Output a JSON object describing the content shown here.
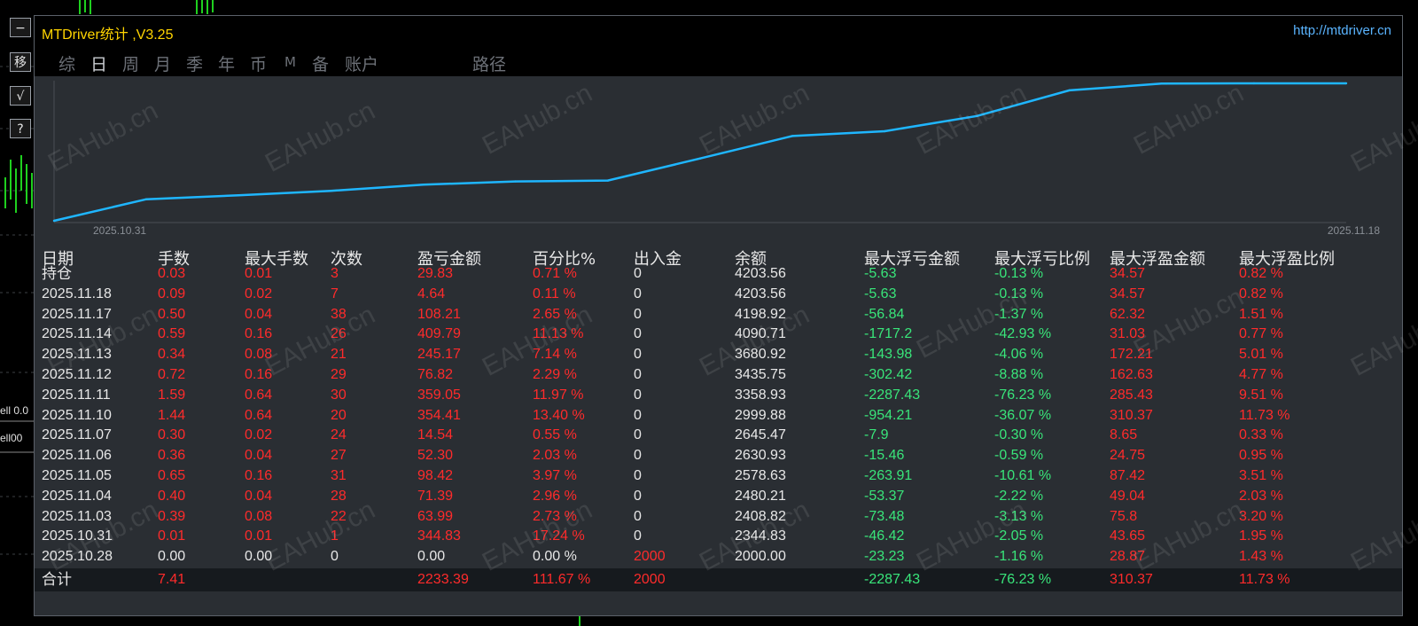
{
  "window": {
    "title": "MTDriver统计 ,V3.25",
    "url": "http://mtdriver.cn"
  },
  "side_buttons": [
    {
      "label": "−",
      "icon": "minimize-icon"
    },
    {
      "label": "移",
      "icon": "move-icon"
    },
    {
      "label": "√",
      "icon": "check-icon"
    },
    {
      "label": "?",
      "icon": "help-icon"
    }
  ],
  "side_labels": [
    "ell 0.0",
    "ell00"
  ],
  "tabs": [
    {
      "label": "综",
      "active": false
    },
    {
      "label": "日",
      "active": true
    },
    {
      "label": "周",
      "active": false
    },
    {
      "label": "月",
      "active": false
    },
    {
      "label": "季",
      "active": false
    },
    {
      "label": "年",
      "active": false
    },
    {
      "label": "币",
      "active": false
    },
    {
      "label": "M",
      "active": false
    },
    {
      "label": "备",
      "active": false
    },
    {
      "label": "账户",
      "active": false
    }
  ],
  "path_label": "路径",
  "watermark_text": "EAHub.cn",
  "chart_data": {
    "type": "line",
    "x": [
      "2025.10.28",
      "2025.10.31",
      "2025.11.03",
      "2025.11.04",
      "2025.11.05",
      "2025.11.06",
      "2025.11.07",
      "2025.11.10",
      "2025.11.11",
      "2025.11.12",
      "2025.11.13",
      "2025.11.14",
      "2025.11.17",
      "2025.11.18",
      "持仓"
    ],
    "y": [
      2000.0,
      2344.83,
      2408.82,
      2480.21,
      2578.63,
      2630.93,
      2645.47,
      2999.88,
      3358.93,
      3435.75,
      3680.92,
      4090.71,
      4198.92,
      4203.56,
      4203.56
    ],
    "x_start_label": "2025.10.31",
    "x_end_label": "2025.11.18",
    "line_color": "#1fb6ff",
    "grid": false
  },
  "table": {
    "headers": [
      "日期",
      "手数",
      "最大手数",
      "次数",
      "盈亏金额",
      "百分比%",
      "出入金",
      "余额",
      "最大浮亏金额",
      "最大浮亏比例",
      "最大浮盈金额",
      "最大浮盈比例"
    ],
    "rows": [
      [
        "持仓",
        "0.03",
        "0.01",
        "3",
        "29.83",
        "0.71 %",
        "0",
        "4203.56",
        "-5.63",
        "-0.13 %",
        "34.57",
        "0.82 %"
      ],
      [
        "2025.11.18",
        "0.09",
        "0.02",
        "7",
        "4.64",
        "0.11 %",
        "0",
        "4203.56",
        "-5.63",
        "-0.13 %",
        "34.57",
        "0.82 %"
      ],
      [
        "2025.11.17",
        "0.50",
        "0.04",
        "38",
        "108.21",
        "2.65 %",
        "0",
        "4198.92",
        "-56.84",
        "-1.37 %",
        "62.32",
        "1.51 %"
      ],
      [
        "2025.11.14",
        "0.59",
        "0.16",
        "26",
        "409.79",
        "11.13 %",
        "0",
        "4090.71",
        "-1717.2",
        "-42.93 %",
        "31.03",
        "0.77 %"
      ],
      [
        "2025.11.13",
        "0.34",
        "0.08",
        "21",
        "245.17",
        "7.14 %",
        "0",
        "3680.92",
        "-143.98",
        "-4.06 %",
        "172.21",
        "5.01 %"
      ],
      [
        "2025.11.12",
        "0.72",
        "0.16",
        "29",
        "76.82",
        "2.29 %",
        "0",
        "3435.75",
        "-302.42",
        "-8.88 %",
        "162.63",
        "4.77 %"
      ],
      [
        "2025.11.11",
        "1.59",
        "0.64",
        "30",
        "359.05",
        "11.97 %",
        "0",
        "3358.93",
        "-2287.43",
        "-76.23 %",
        "285.43",
        "9.51 %"
      ],
      [
        "2025.11.10",
        "1.44",
        "0.64",
        "20",
        "354.41",
        "13.40 %",
        "0",
        "2999.88",
        "-954.21",
        "-36.07 %",
        "310.37",
        "11.73 %"
      ],
      [
        "2025.11.07",
        "0.30",
        "0.02",
        "24",
        "14.54",
        "0.55 %",
        "0",
        "2645.47",
        "-7.9",
        "-0.30 %",
        "8.65",
        "0.33 %"
      ],
      [
        "2025.11.06",
        "0.36",
        "0.04",
        "27",
        "52.30",
        "2.03 %",
        "0",
        "2630.93",
        "-15.46",
        "-0.59 %",
        "24.75",
        "0.95 %"
      ],
      [
        "2025.11.05",
        "0.65",
        "0.16",
        "31",
        "98.42",
        "3.97 %",
        "0",
        "2578.63",
        "-263.91",
        "-10.61 %",
        "87.42",
        "3.51 %"
      ],
      [
        "2025.11.04",
        "0.40",
        "0.04",
        "28",
        "71.39",
        "2.96 %",
        "0",
        "2480.21",
        "-53.37",
        "-2.22 %",
        "49.04",
        "2.03 %"
      ],
      [
        "2025.11.03",
        "0.39",
        "0.08",
        "22",
        "63.99",
        "2.73 %",
        "0",
        "2408.82",
        "-73.48",
        "-3.13 %",
        "75.8",
        "3.20 %"
      ],
      [
        "2025.10.31",
        "0.01",
        "0.01",
        "1",
        "344.83",
        "17.24 %",
        "0",
        "2344.83",
        "-46.42",
        "-2.05 %",
        "43.65",
        "1.95 %"
      ],
      [
        "2025.10.28",
        "0.00",
        "0.00",
        "0",
        "0.00",
        "0.00 %",
        "2000",
        "2000.00",
        "-23.23",
        "-1.16 %",
        "28.87",
        "1.43 %"
      ]
    ],
    "total": [
      "合计",
      "7.41",
      "",
      "",
      "2233.39",
      "111.67 %",
      "2000",
      "",
      "-2287.43",
      "-76.23 %",
      "310.37",
      "11.73 %"
    ]
  },
  "colors": {
    "positive": "#ff2b2b",
    "negative": "#39e57a",
    "neutral": "#e8e8e8",
    "title": "#ffd400",
    "url": "#5ab4ff"
  }
}
